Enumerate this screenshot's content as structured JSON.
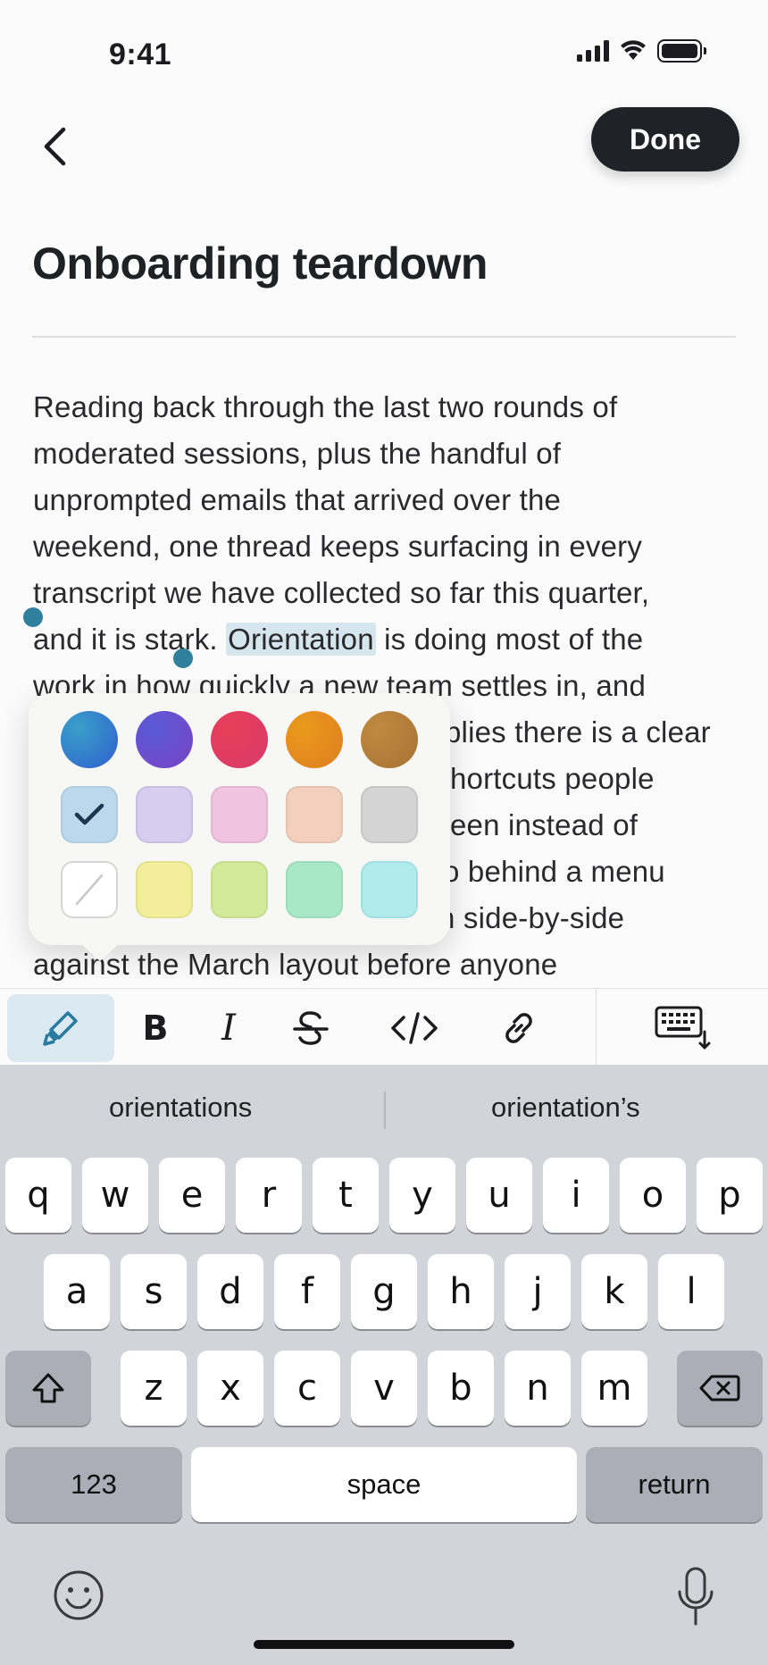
{
  "status_bar": {
    "time": "9:41"
  },
  "nav": {
    "done_label": "Done"
  },
  "note": {
    "title": "Onboarding teardown",
    "lines": [
      "Reading back through the last two rounds of",
      "moderated sessions, plus the handful of",
      "unprompted emails that arrived over the",
      "weekend, one thread keeps surfacing in every",
      "transcript we have collected so far this quarter,"
    ],
    "line6_before": "and it is stark. ",
    "selected_word": "Orientation",
    "line6_after": " is doing most of the",
    "line7": "work in how quickly a new team settles in, and",
    "partial_lines": [
      "plies there is a clear",
      "hortcuts people",
      "een instead of",
      "o behind a menu",
      "n side-by-side"
    ],
    "line_last": "against the March layout before anyone"
  },
  "color_picker": {
    "text_colors": [
      "#2f6fc9",
      "#6a4bc6",
      "#dd3a5c",
      "#e58a1c",
      "#b47d3c"
    ],
    "highlight_colors": [
      "#bcd9ec",
      "#d6cdef",
      "#f0c3df",
      "#f3cfbd",
      "#d4d4d4"
    ],
    "selected_highlight": "#bcd9ec",
    "more_highlights": [
      "none",
      "#f2ee9a",
      "#d4ea9b",
      "#a9e8c7",
      "#b0ecec"
    ]
  },
  "toolbar": {
    "buttons": [
      "highlighter-icon",
      "bold-icon",
      "italic-icon",
      "strikethrough-icon",
      "code-icon",
      "link-icon",
      "keyboard-dismiss-icon"
    ]
  },
  "keyboard": {
    "suggestions": [
      "orientations",
      "orientation’s"
    ],
    "row1": [
      "q",
      "w",
      "e",
      "r",
      "t",
      "y",
      "u",
      "i",
      "o",
      "p"
    ],
    "row2": [
      "a",
      "s",
      "d",
      "f",
      "g",
      "h",
      "j",
      "k",
      "l"
    ],
    "row3": [
      "z",
      "x",
      "c",
      "v",
      "b",
      "n",
      "m"
    ],
    "numbers_label": "123",
    "space_label": "space",
    "return_label": "return"
  }
}
